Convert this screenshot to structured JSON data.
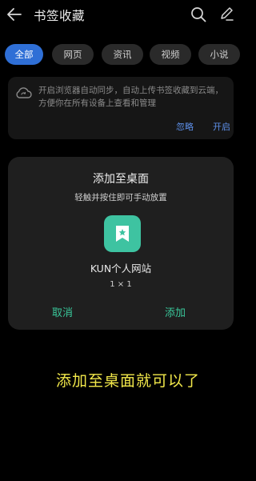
{
  "header": {
    "title": "书签收藏",
    "back_icon": "back-arrow-icon",
    "search_icon": "search-icon",
    "edit_icon": "edit-pencil-icon"
  },
  "tabs": [
    {
      "label": "全部",
      "active": true
    },
    {
      "label": "网页",
      "active": false
    },
    {
      "label": "资讯",
      "active": false
    },
    {
      "label": "视频",
      "active": false
    },
    {
      "label": "小说",
      "active": false
    }
  ],
  "sync_card": {
    "icon": "cloud-sync-icon",
    "text": "开启浏览器自动同步，自动上传书签收藏到云端，方便你在所有设备上查看和管理",
    "ignore_label": "忽略",
    "open_label": "开启"
  },
  "dialog": {
    "title": "添加至桌面",
    "subtitle": "轻触并按住即可手动放置",
    "app_icon": "bookmark-star-icon",
    "app_name": "KUN个人网站",
    "app_size": "1 × 1",
    "cancel_label": "取消",
    "add_label": "添加"
  },
  "caption": "添加至桌面就可以了",
  "colors": {
    "background": "#000000",
    "accent_blue": "#2f6fd6",
    "accent_green": "#39c79a",
    "app_icon_bg": "#3ec3a1",
    "caption_yellow": "#f2e84a"
  }
}
